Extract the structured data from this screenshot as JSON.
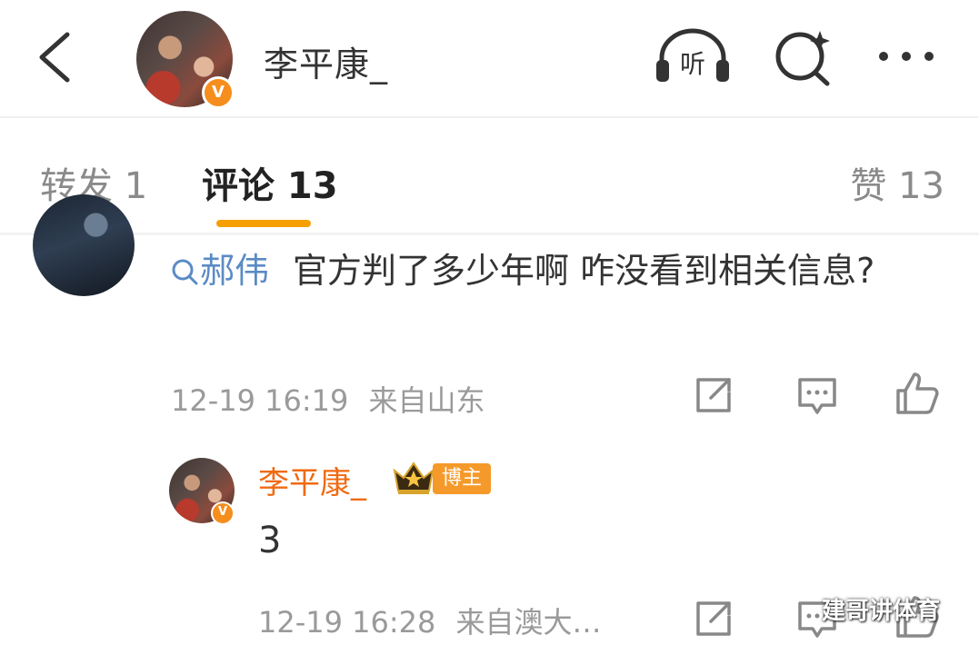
{
  "header": {
    "title": "李平康_",
    "verified_mark": "V",
    "icons": {
      "back": "back-chevron-icon",
      "listen": "headphones-icon",
      "listen_label": "听",
      "search": "search-sparkle-icon",
      "more": "more-dots-icon"
    }
  },
  "tabs": [
    {
      "label": "转发 1"
    },
    {
      "label": "评论 13"
    },
    {
      "label": "赞 13"
    }
  ],
  "comment": {
    "mention": "郝伟",
    "text": "官方判了多少年啊 咋没看到相关信息?",
    "time": "12-19 16:19",
    "location": "来自山东"
  },
  "reply": {
    "author": "李平康_",
    "badge": "博主",
    "verified_mark": "V",
    "text": "3",
    "time": "12-19 16:28",
    "location": "来自澳大…"
  },
  "watermark": "建哥讲体育",
  "colors": {
    "accent_orange": "#f5a000",
    "author_orange": "#f06a12",
    "mention_blue": "#5b8bc4",
    "meta_gray": "#9a9a9a"
  }
}
